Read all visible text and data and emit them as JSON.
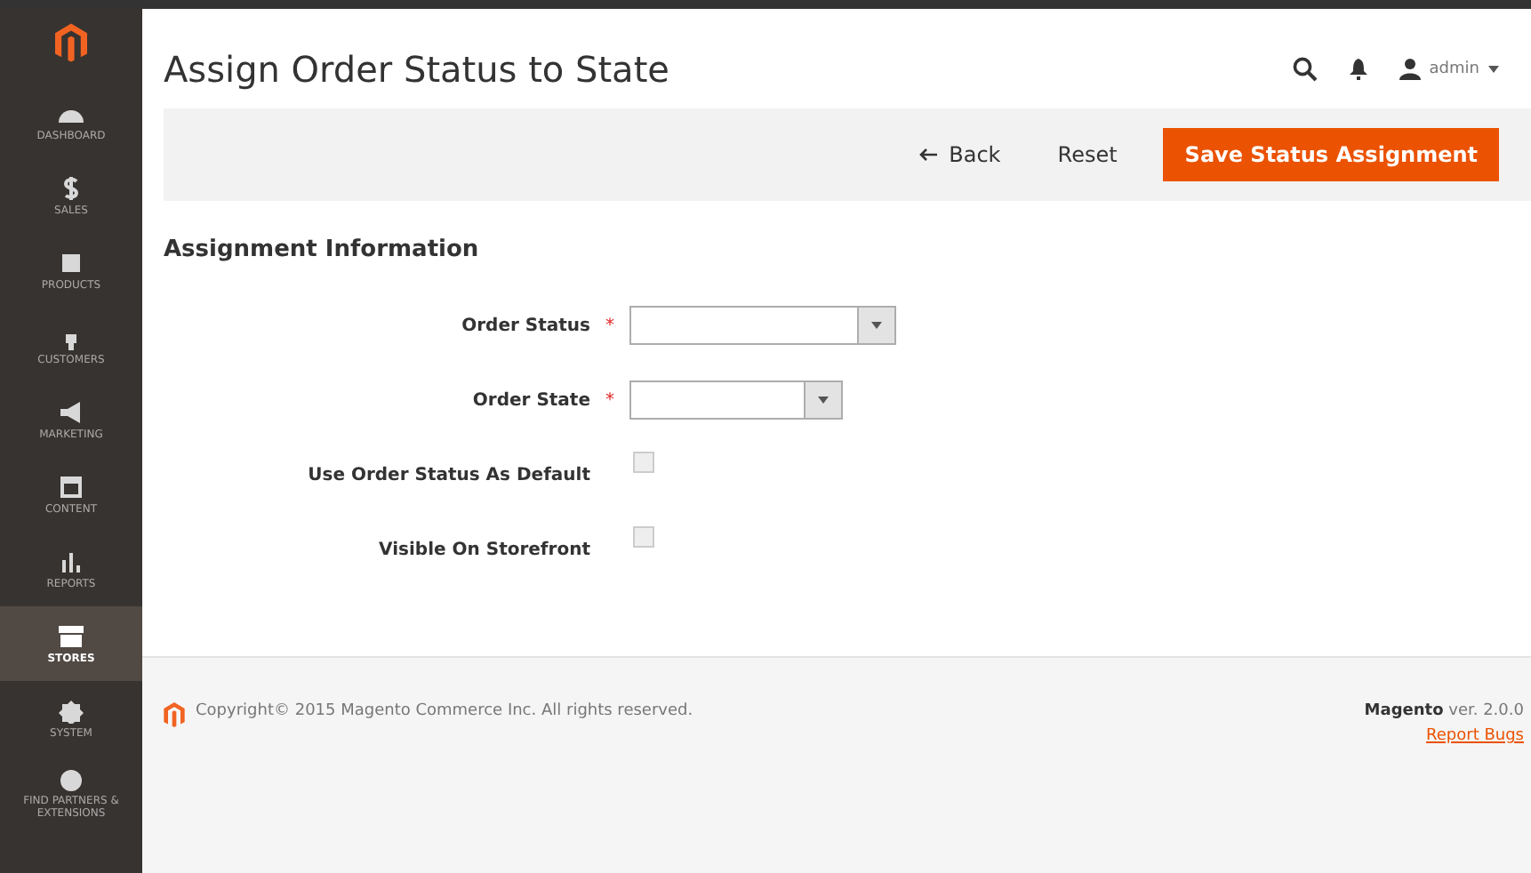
{
  "sidebar": {
    "items": [
      {
        "label": "DASHBOARD",
        "selected": false
      },
      {
        "label": "SALES",
        "selected": false
      },
      {
        "label": "PRODUCTS",
        "selected": false
      },
      {
        "label": "CUSTOMERS",
        "selected": false
      },
      {
        "label": "MARKETING",
        "selected": false
      },
      {
        "label": "CONTENT",
        "selected": false
      },
      {
        "label": "REPORTS",
        "selected": false
      },
      {
        "label": "STORES",
        "selected": true
      },
      {
        "label": "SYSTEM",
        "selected": false
      },
      {
        "label": "FIND PARTNERS & EXTENSIONS",
        "selected": false
      }
    ]
  },
  "header": {
    "title": "Assign Order Status to State",
    "user": "admin"
  },
  "actions": {
    "back": "Back",
    "reset": "Reset",
    "save": "Save Status Assignment"
  },
  "form": {
    "heading": "Assignment Information",
    "required_mark": "*",
    "fields": [
      {
        "kind": "select",
        "label": "Order Status",
        "required": true
      },
      {
        "kind": "select",
        "label": "Order State",
        "required": true
      },
      {
        "kind": "checkbox",
        "label": "Use Order Status As Default",
        "required": false,
        "checked": false
      },
      {
        "kind": "checkbox",
        "label": "Visible On Storefront",
        "required": false,
        "checked": false
      }
    ]
  },
  "footer": {
    "copyright": "Copyright© 2015 Magento Commerce Inc. All rights reserved.",
    "version": "**Magento** ver. 2.0.0",
    "report": "Report Bugs"
  }
}
